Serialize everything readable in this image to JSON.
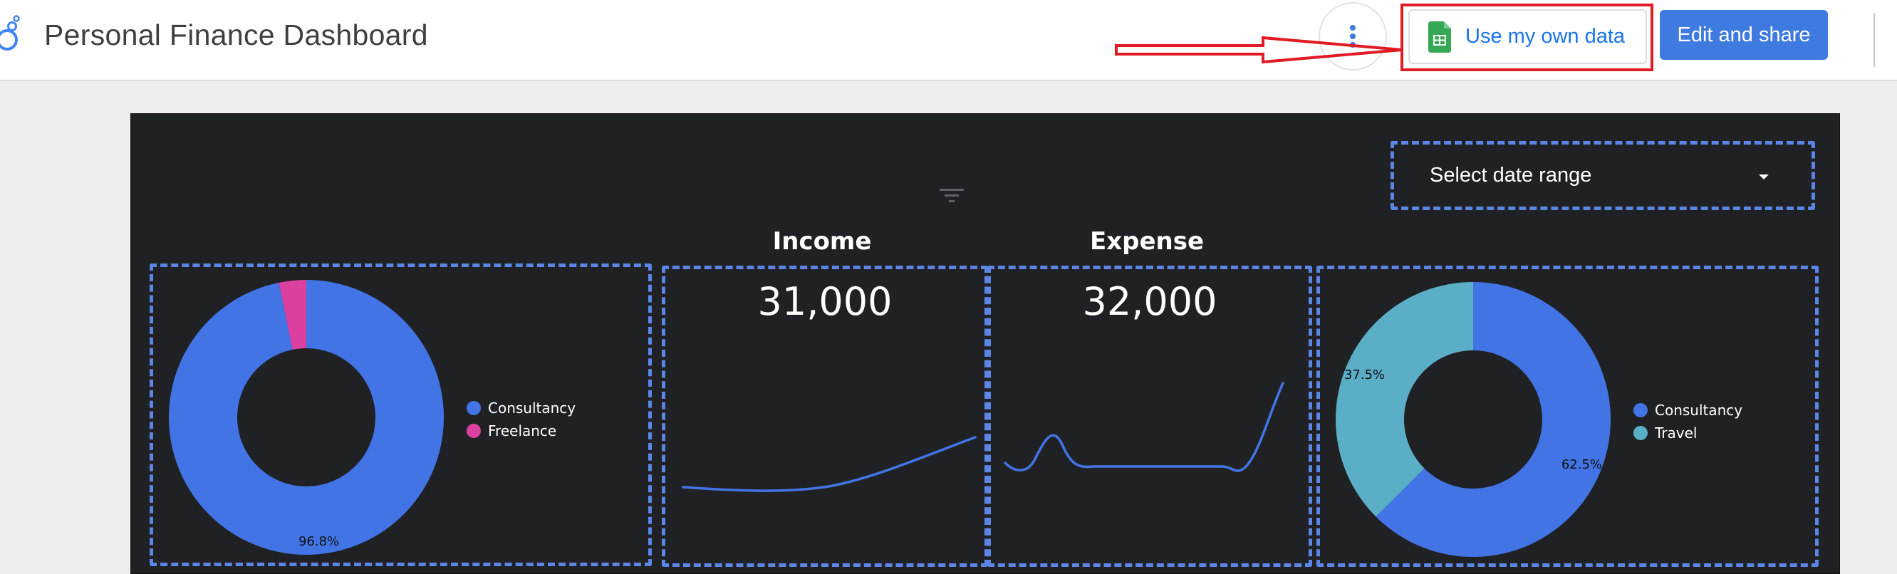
{
  "header": {
    "title": "Personal Finance Dashboard",
    "use_own_data_label": "Use my own data",
    "edit_share_label": "Edit and share",
    "icons": [
      "looker-studio-logo-icon",
      "more-vert-icon",
      "google-sheets-icon"
    ]
  },
  "report": {
    "date_range_label": "Select date range",
    "income": {
      "title": "Income",
      "value": "31,000"
    },
    "expense": {
      "title": "Expense",
      "value": "32,000"
    },
    "income_breakdown": {
      "legend": [
        {
          "label": "Consultancy",
          "color": "#4274e6"
        },
        {
          "label": "Freelance",
          "color": "#db3fa0"
        }
      ],
      "slices": [
        {
          "label": "Consultancy",
          "value": 96.8,
          "display": "96.8%",
          "color": "#4274e6"
        },
        {
          "label": "Freelance",
          "value": 3.2,
          "display": "",
          "color": "#db3fa0"
        }
      ]
    },
    "expense_breakdown": {
      "legend": [
        {
          "label": "Consultancy",
          "color": "#4274e6"
        },
        {
          "label": "Travel",
          "color": "#5aaec6"
        }
      ],
      "slices": [
        {
          "label": "Consultancy",
          "value": 62.5,
          "display": "62.5%",
          "color": "#4274e6"
        },
        {
          "label": "Travel",
          "value": 37.5,
          "display": "37.5%",
          "color": "#5aaec6"
        }
      ]
    }
  },
  "colors": {
    "accent": "#3f7ae0",
    "link": "#1a73e8",
    "canvas": "#202124",
    "dashed_outline": "#5b86e5",
    "annotation": "#e01b24"
  }
}
